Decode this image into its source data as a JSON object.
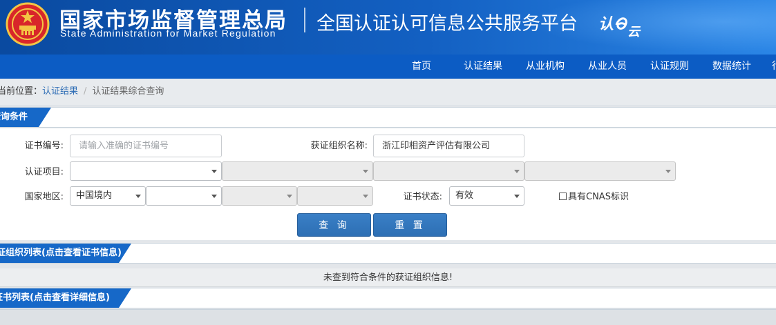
{
  "header": {
    "agency_cn": "国家市场监督管理总局",
    "agency_en": "State Administration  for  Market Regulation",
    "platform_title": "全国认证认可信息公共服务平台",
    "brand_logo_text": "认e云",
    "emblem_icon": "national-emblem-icon",
    "colors": {
      "banner": "#1360c2",
      "nav": "#0c5cc4"
    }
  },
  "nav": {
    "items": [
      "首页",
      "认证结果",
      "从业机构",
      "从业人员",
      "认证规则",
      "数据统计",
      "行"
    ]
  },
  "breadcrumb": {
    "label": "当前位置：",
    "link": "认证结果",
    "separator": "/",
    "current": "认证结果综合查询"
  },
  "query_section": {
    "title": "查询条件",
    "cert_no_label": "证书编号:",
    "cert_no_placeholder": "请输入准确的证书编号",
    "org_name_label": "获证组织名称:",
    "org_name_value": "浙江印相资产评估有限公司",
    "cert_item_label": "认证项目:",
    "region_label": "国家地区:",
    "region_value": "中国境内",
    "status_label": "证书状态:",
    "status_value": "有效",
    "cnas_label": "具有CNAS标识",
    "search_button": "查 询",
    "reset_button": "重 置"
  },
  "org_list": {
    "title": "获证组织列表(点击查看证书信息)",
    "empty_message": "未查到符合条件的获证组织信息!"
  },
  "cert_list": {
    "title": "证书列表(点击查看详细信息)"
  }
}
